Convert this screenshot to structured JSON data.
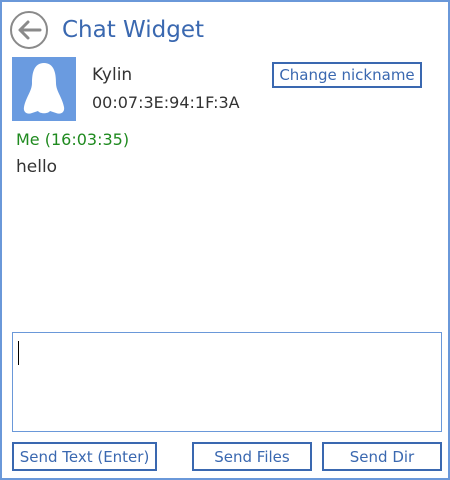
{
  "header": {
    "title": "Chat Widget",
    "back_icon": "back-arrow-icon"
  },
  "contact": {
    "name": "Kylin",
    "mac": "00:07:3E:94:1F:3A",
    "avatar_icon": "penguin-avatar-icon",
    "change_nickname_label": "Change nickname"
  },
  "messages": [
    {
      "meta": "Me (16:03:35)",
      "text": "hello"
    }
  ],
  "input": {
    "value": ""
  },
  "actions": {
    "send_text_label": "Send Text (Enter)",
    "send_files_label": "Send Files",
    "send_dir_label": "Send Dir"
  },
  "colors": {
    "accent": "#3a68b0",
    "border": "#6a98d9",
    "avatar_bg": "#6a9be0",
    "message_meta": "#1f8a1f"
  }
}
